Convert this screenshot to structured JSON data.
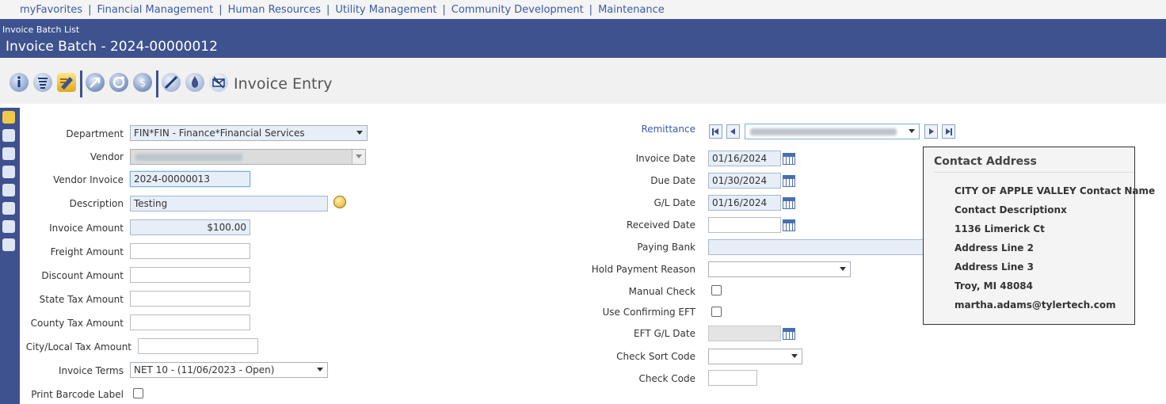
{
  "nav": {
    "items": [
      "myFavorites",
      "Financial Management",
      "Human Resources",
      "Utility Management",
      "Community Development",
      "Maintenance"
    ],
    "separator": "|"
  },
  "header": {
    "breadcrumb": "Invoice Batch List",
    "title": "Invoice Batch - 2024-00000012"
  },
  "toolbar": {
    "title": "Invoice Entry",
    "icons": [
      "info-icon",
      "list-icon",
      "edit-invoice-icon",
      "post-icon",
      "refresh-icon",
      "money-icon",
      "approve-icon",
      "attach-icon",
      "email-icon"
    ]
  },
  "left_form": {
    "department": {
      "label": "Department",
      "value": "FIN*FIN - Finance*Financial Services"
    },
    "vendor": {
      "label": "Vendor"
    },
    "vendor_invoice": {
      "label": "Vendor Invoice",
      "value": "2024-00000013"
    },
    "description": {
      "label": "Description",
      "value": "Testing"
    },
    "invoice_amount": {
      "label": "Invoice Amount",
      "value": "$100.00"
    },
    "freight_amount": {
      "label": "Freight Amount",
      "value": ""
    },
    "discount_amount": {
      "label": "Discount Amount",
      "value": ""
    },
    "state_tax_amount": {
      "label": "State Tax Amount",
      "value": ""
    },
    "county_tax_amount": {
      "label": "County Tax Amount",
      "value": ""
    },
    "city_tax_amount": {
      "label": "City/Local Tax Amount",
      "value": ""
    },
    "invoice_terms": {
      "label": "Invoice Terms",
      "value": "NET 10 - (11/06/2023 - Open)"
    },
    "print_barcode": {
      "label": "Print Barcode Label",
      "checked": false
    }
  },
  "right_form": {
    "remittance": {
      "label": "Remittance"
    },
    "invoice_date": {
      "label": "Invoice Date",
      "value": "01/16/2024"
    },
    "due_date": {
      "label": "Due Date",
      "value": "01/30/2024"
    },
    "gl_date": {
      "label": "G/L Date",
      "value": "01/16/2024"
    },
    "received_date": {
      "label": "Received Date",
      "value": ""
    },
    "paying_bank": {
      "label": "Paying Bank",
      "value": ""
    },
    "hold_payment": {
      "label": "Hold Payment Reason",
      "value": ""
    },
    "manual_check": {
      "label": "Manual Check",
      "checked": false
    },
    "confirming_eft": {
      "label": "Use Confirming EFT",
      "checked": false
    },
    "eft_gl_date": {
      "label": "EFT G/L Date",
      "value": ""
    },
    "check_sort": {
      "label": "Check Sort Code",
      "value": ""
    },
    "check_code": {
      "label": "Check Code",
      "value": ""
    }
  },
  "contact": {
    "title": "Contact Address",
    "lines": [
      "CITY OF APPLE VALLEY Contact Name",
      "Contact Descriptionx",
      "1136 Limerick Ct",
      "Address Line 2",
      "Address Line 3",
      "Troy, MI 48084",
      "martha.adams@tylertech.com"
    ]
  },
  "colors": {
    "header": "#3d528e",
    "link": "#3a5aa8",
    "field_tint": "#e6eef8"
  }
}
